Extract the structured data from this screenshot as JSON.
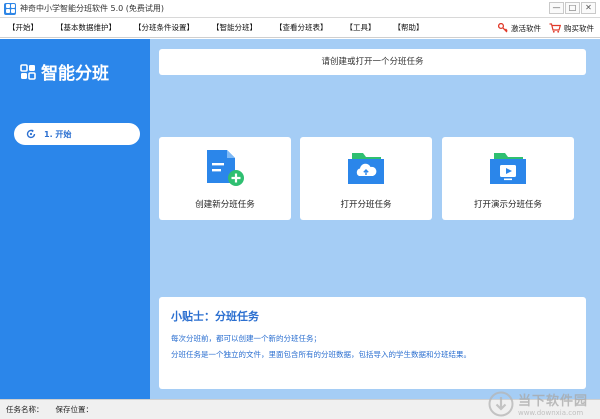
{
  "window": {
    "title": "神奇中小学智能分班软件 5.0 (免费试用)",
    "controls": [
      "—",
      "□",
      "✕"
    ]
  },
  "menu": {
    "items": [
      "【开始】",
      "【基本数据维护】",
      "【分班条件设置】",
      "【智能分班】",
      "【查看分班表】",
      "【工具】",
      "【帮助】"
    ],
    "activate_label": "激活软件",
    "buy_label": "购买软件"
  },
  "sidebar": {
    "brand": "智能分班",
    "nav": [
      {
        "label": "1. 开始",
        "active": true
      }
    ]
  },
  "main": {
    "prompt": "请创建或打开一个分班任务",
    "cards": [
      {
        "label": "创建新分班任务",
        "icon": "new-file-icon"
      },
      {
        "label": "打开分班任务",
        "icon": "cloud-folder-icon"
      },
      {
        "label": "打开演示分班任务",
        "icon": "play-folder-icon"
      }
    ],
    "tips": {
      "title": "小贴士：分班任务",
      "lines": [
        "每次分班前，都可以创建一个新的分班任务；",
        "分班任务是一个独立的文件，里面包含所有的分班数据，包括导入的学生数据和分班结果。"
      ]
    }
  },
  "status": {
    "task_name_label": "任务名称：",
    "save_location_label": "保存位置："
  },
  "watermark": {
    "name": "当下软件园",
    "url": "www.downxia.com"
  },
  "colors": {
    "sidebar": "#2b86ea",
    "main_bg": "#a5cdf5",
    "accent": "#2b6fd0"
  }
}
